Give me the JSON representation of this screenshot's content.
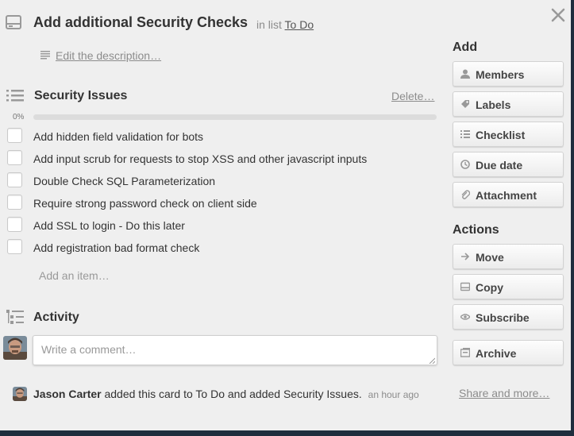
{
  "card": {
    "title": "Add additional Security Checks",
    "in_list_prefix": "in list",
    "list_name": "To Do",
    "edit_description": "Edit the description…"
  },
  "checklist": {
    "title": "Security Issues",
    "delete_label": "Delete…",
    "progress_label": "0%",
    "progress": 0,
    "items": [
      "Add hidden field validation for bots",
      "Add input scrub for requests to stop XSS and other javascript inputs",
      "Double Check SQL Parameterization",
      "Require strong password check on client side",
      "Add SSL to login - Do this later",
      "Add registration bad format check"
    ],
    "add_item": "Add an item…"
  },
  "activity": {
    "title": "Activity",
    "comment_placeholder": "Write a comment…",
    "entry": {
      "user": "Jason Carter",
      "text": "added this card to To Do and added Security Issues.",
      "time": "an hour ago"
    },
    "share_link": "Share and more…"
  },
  "sidebar": {
    "add_heading": "Add",
    "add_buttons": [
      {
        "label": "Members",
        "icon": "person-icon"
      },
      {
        "label": "Labels",
        "icon": "tag-icon"
      },
      {
        "label": "Checklist",
        "icon": "checklist-icon"
      },
      {
        "label": "Due date",
        "icon": "clock-icon"
      },
      {
        "label": "Attachment",
        "icon": "paperclip-icon"
      }
    ],
    "actions_heading": "Actions",
    "action_buttons": [
      {
        "label": "Move",
        "icon": "arrow-right-icon"
      },
      {
        "label": "Copy",
        "icon": "card-icon"
      },
      {
        "label": "Subscribe",
        "icon": "eye-icon"
      },
      {
        "label": "Archive",
        "icon": "archive-icon"
      }
    ]
  },
  "colors": {
    "background": "#1f2d3d",
    "panel": "#efefef",
    "progress_fill": "#4c9a3f"
  }
}
